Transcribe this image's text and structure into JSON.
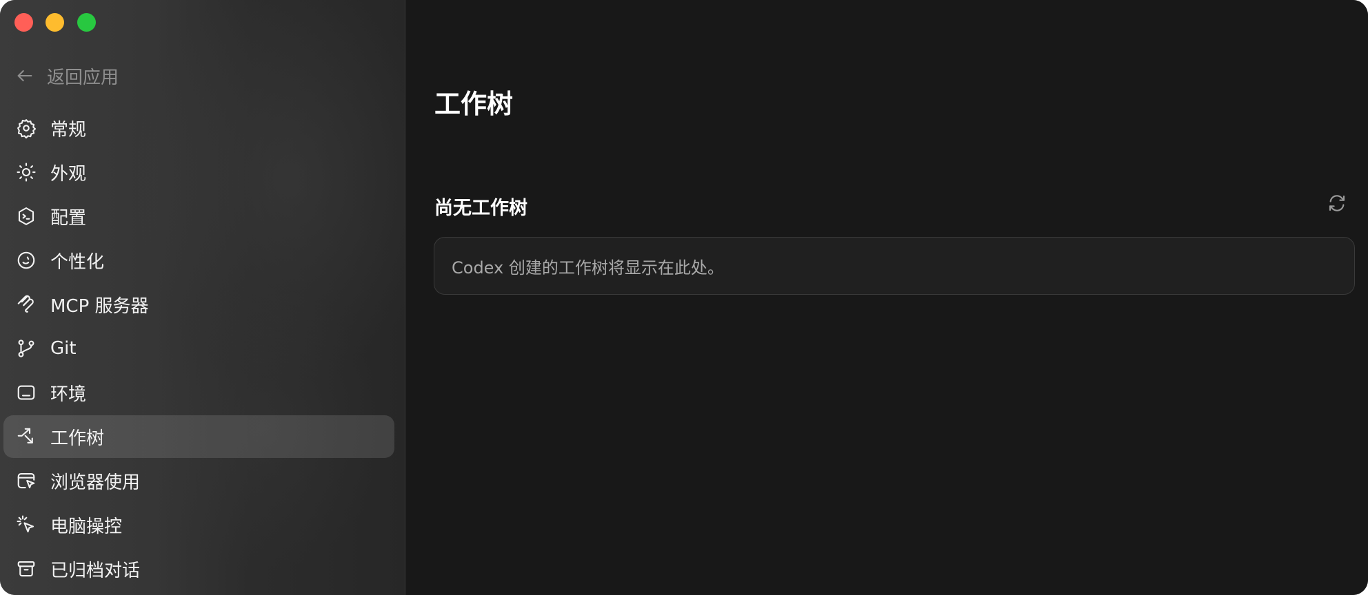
{
  "sidebar": {
    "back_label": "返回应用",
    "items": [
      {
        "label": "常规",
        "icon": "gear-icon"
      },
      {
        "label": "外观",
        "icon": "sun-icon"
      },
      {
        "label": "配置",
        "icon": "shield-terminal-icon"
      },
      {
        "label": "个性化",
        "icon": "smile-icon"
      },
      {
        "label": "MCP 服务器",
        "icon": "mcp-icon"
      },
      {
        "label": "Git",
        "icon": "git-branch-icon"
      },
      {
        "label": "环境",
        "icon": "environment-icon"
      },
      {
        "label": "工作树",
        "icon": "worktree-icon",
        "active": true
      },
      {
        "label": "浏览器使用",
        "icon": "browser-cursor-icon"
      },
      {
        "label": "电脑操控",
        "icon": "click-cursor-icon"
      },
      {
        "label": "已归档对话",
        "icon": "archive-icon"
      }
    ]
  },
  "main": {
    "title": "工作树",
    "section_title": "尚无工作树",
    "empty_message": "Codex 创建的工作树将显示在此处。"
  },
  "colors": {
    "window_bg": "#181818",
    "sidebar_active": "rgba(255,255,255,0.12)",
    "traffic_red": "#ff5f57",
    "traffic_yellow": "#febc2e",
    "traffic_green": "#28c840"
  }
}
